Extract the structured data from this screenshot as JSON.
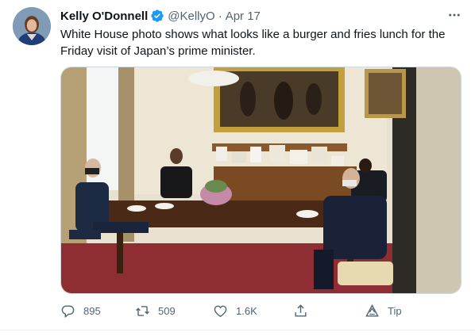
{
  "author": {
    "name": "Kelly O'Donnell",
    "handle": "@KellyO",
    "separator": "·",
    "date": "Apr 17",
    "verified": true,
    "avatar_icon": "profile-photo"
  },
  "tweet": {
    "text": "White House photo shows what looks like a burger and fries lunch for the Friday visit of Japan’s prime minister."
  },
  "media": {
    "type": "photo",
    "subject": "white-house-lunch-photo"
  },
  "actions": {
    "reply_count": "895",
    "retweet_count": "509",
    "like_count": "1.6K",
    "tip_label": "Tip"
  },
  "icons": {
    "reply": "reply-icon",
    "retweet": "retweet-icon",
    "like": "heart-icon",
    "share": "share-icon",
    "tip": "tip-icon",
    "more": "more-options-icon",
    "verified": "verified-badge-icon"
  },
  "colors": {
    "text_primary": "#0f1419",
    "text_secondary": "#536471",
    "verified_blue": "#1d9bf0",
    "border": "#cfd9de"
  }
}
